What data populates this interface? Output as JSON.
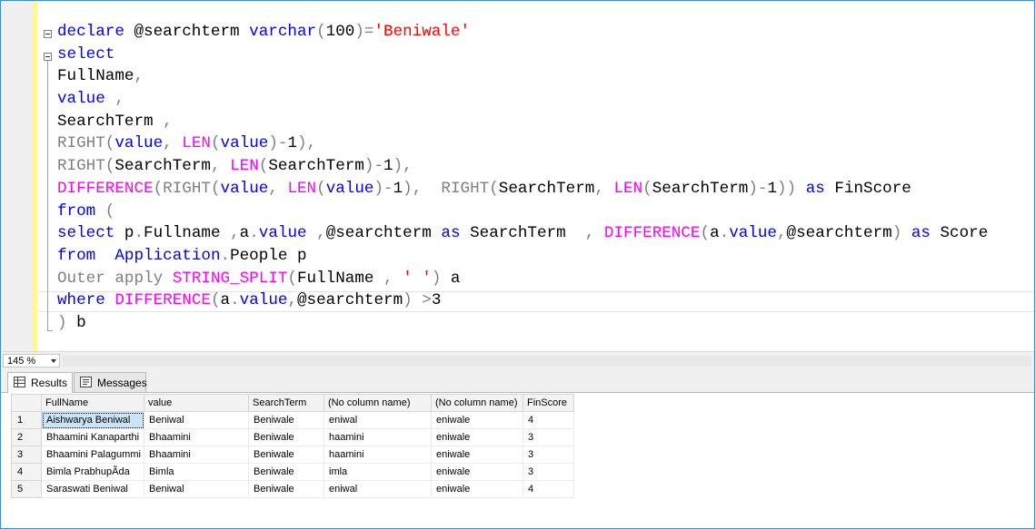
{
  "editor": {
    "lines": [
      [
        {
          "t": "declare",
          "c": "kw"
        },
        {
          "t": " @searchterm "
        },
        {
          "t": "varchar",
          "c": "kw"
        },
        {
          "t": "(",
          "c": "gr"
        },
        {
          "t": "100"
        },
        {
          "t": ")=",
          "c": "gr"
        },
        {
          "t": "'Beniwale'",
          "c": "st"
        }
      ],
      [
        {
          "t": "select",
          "c": "kw"
        }
      ],
      [
        {
          "t": "FullName"
        },
        {
          "t": ",",
          "c": "gr"
        }
      ],
      [
        {
          "t": "value",
          "c": "kw"
        },
        {
          "t": " ,",
          "c": "gr"
        }
      ],
      [
        {
          "t": "SearchTerm "
        },
        {
          "t": ",",
          "c": "gr"
        }
      ],
      [
        {
          "t": "RIGHT",
          "c": "gr"
        },
        {
          "t": "(",
          "c": "gr"
        },
        {
          "t": "value",
          "c": "kw"
        },
        {
          "t": ", ",
          "c": "gr"
        },
        {
          "t": "LEN",
          "c": "fn"
        },
        {
          "t": "(",
          "c": "gr"
        },
        {
          "t": "value",
          "c": "kw"
        },
        {
          "t": ")-",
          "c": "gr"
        },
        {
          "t": "1"
        },
        {
          "t": "),",
          "c": "gr"
        }
      ],
      [
        {
          "t": "RIGHT",
          "c": "gr"
        },
        {
          "t": "(",
          "c": "gr"
        },
        {
          "t": "SearchTerm"
        },
        {
          "t": ", ",
          "c": "gr"
        },
        {
          "t": "LEN",
          "c": "fn"
        },
        {
          "t": "(",
          "c": "gr"
        },
        {
          "t": "SearchTerm"
        },
        {
          "t": ")-",
          "c": "gr"
        },
        {
          "t": "1"
        },
        {
          "t": "),",
          "c": "gr"
        }
      ],
      [
        {
          "t": "DIFFERENCE",
          "c": "fn"
        },
        {
          "t": "(",
          "c": "gr"
        },
        {
          "t": "RIGHT",
          "c": "gr"
        },
        {
          "t": "(",
          "c": "gr"
        },
        {
          "t": "value",
          "c": "kw"
        },
        {
          "t": ", ",
          "c": "gr"
        },
        {
          "t": "LEN",
          "c": "fn"
        },
        {
          "t": "(",
          "c": "gr"
        },
        {
          "t": "value",
          "c": "kw"
        },
        {
          "t": ")-",
          "c": "gr"
        },
        {
          "t": "1"
        },
        {
          "t": "),  ",
          "c": "gr"
        },
        {
          "t": "RIGHT",
          "c": "gr"
        },
        {
          "t": "(",
          "c": "gr"
        },
        {
          "t": "SearchTerm"
        },
        {
          "t": ", ",
          "c": "gr"
        },
        {
          "t": "LEN",
          "c": "fn"
        },
        {
          "t": "(",
          "c": "gr"
        },
        {
          "t": "SearchTerm"
        },
        {
          "t": ")-",
          "c": "gr"
        },
        {
          "t": "1"
        },
        {
          "t": ")) ",
          "c": "gr"
        },
        {
          "t": "as",
          "c": "kw"
        },
        {
          "t": " FinScore"
        }
      ],
      [
        {
          "t": "from",
          "c": "kw"
        },
        {
          "t": " (",
          "c": "gr"
        }
      ],
      [
        {
          "t": "select",
          "c": "kw"
        },
        {
          "t": " p"
        },
        {
          "t": ".",
          "c": "gr"
        },
        {
          "t": "Fullname "
        },
        {
          "t": ",",
          "c": "gr"
        },
        {
          "t": "a"
        },
        {
          "t": ".",
          "c": "gr"
        },
        {
          "t": "value",
          "c": "kw"
        },
        {
          "t": " ,",
          "c": "gr"
        },
        {
          "t": "@searchterm "
        },
        {
          "t": "as",
          "c": "kw"
        },
        {
          "t": " SearchTerm  "
        },
        {
          "t": ", ",
          "c": "gr"
        },
        {
          "t": "DIFFERENCE",
          "c": "fn"
        },
        {
          "t": "(",
          "c": "gr"
        },
        {
          "t": "a"
        },
        {
          "t": ".",
          "c": "gr"
        },
        {
          "t": "value",
          "c": "kw"
        },
        {
          "t": ",",
          "c": "gr"
        },
        {
          "t": "@searchterm"
        },
        {
          "t": ") ",
          "c": "gr"
        },
        {
          "t": "as",
          "c": "kw"
        },
        {
          "t": " Score"
        }
      ],
      [
        {
          "t": "from",
          "c": "kw"
        },
        {
          "t": "  "
        },
        {
          "t": "Application",
          "c": "kw"
        },
        {
          "t": ".",
          "c": "gr"
        },
        {
          "t": "People p"
        }
      ],
      [
        {
          "t": "Outer apply ",
          "c": "gr"
        },
        {
          "t": "STRING_SPLIT",
          "c": "fn"
        },
        {
          "t": "(",
          "c": "gr"
        },
        {
          "t": "FullName "
        },
        {
          "t": ", ",
          "c": "gr"
        },
        {
          "t": "' '",
          "c": "st"
        },
        {
          "t": ")",
          "c": "gr"
        },
        {
          "t": " a"
        }
      ],
      [
        {
          "t": "where",
          "c": "kw"
        },
        {
          "t": " "
        },
        {
          "t": "DIFFERENCE",
          "c": "fn"
        },
        {
          "t": "(",
          "c": "gr"
        },
        {
          "t": "a"
        },
        {
          "t": ".",
          "c": "gr"
        },
        {
          "t": "value",
          "c": "kw"
        },
        {
          "t": ",",
          "c": "gr"
        },
        {
          "t": "@searchterm"
        },
        {
          "t": ") >",
          "c": "gr"
        },
        {
          "t": "3"
        }
      ],
      [
        {
          "t": ")",
          "c": "gr"
        },
        {
          "t": " b"
        }
      ]
    ]
  },
  "zoom": {
    "value": "145 %"
  },
  "tabs": {
    "results": "Results",
    "messages": "Messages"
  },
  "grid": {
    "columns": [
      "FullName",
      "value",
      "SearchTerm",
      "(No column name)",
      "(No column name)",
      "FinScore"
    ],
    "rows": [
      [
        "1",
        "Aishwarya Beniwal",
        "Beniwal",
        "Beniwale",
        "eniwal",
        "eniwale",
        "4"
      ],
      [
        "2",
        "Bhaamini Kanaparthi",
        "Bhaamini",
        "Beniwale",
        "haamini",
        "eniwale",
        "3"
      ],
      [
        "3",
        "Bhaamini Palagummi",
        "Bhaamini",
        "Beniwale",
        "haamini",
        "eniwale",
        "3"
      ],
      [
        "4",
        "Bimla PrabhupÃda",
        "Bimla",
        "Beniwale",
        "imla",
        "eniwale",
        "3"
      ],
      [
        "5",
        "Saraswati Beniwal",
        "Beniwal",
        "Beniwale",
        "eniwal",
        "eniwale",
        "4"
      ]
    ]
  }
}
